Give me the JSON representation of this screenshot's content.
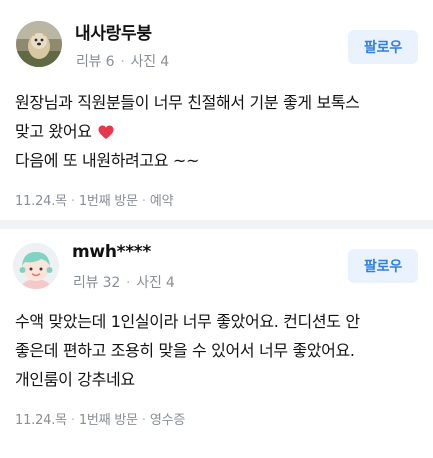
{
  "reviews": [
    {
      "author": "내사랑두붕",
      "stats": {
        "reviews": "리뷰 6",
        "photos": "사진 4"
      },
      "follow_label": "팔로우",
      "body": {
        "line1": "원장님과 직원분들이 너무 친절해서 기분 좋게 보톡스",
        "line2": "맞고 왔어요",
        "line3": "다음에 또 내원하려고요 ~~"
      },
      "meta": {
        "date": "11.24.목",
        "visit": "1번째 방문",
        "verification": "예약"
      }
    },
    {
      "author": "mwh****",
      "stats": {
        "reviews": "리뷰 32",
        "photos": "사진 4"
      },
      "follow_label": "팔로우",
      "body": {
        "line1": "수액 맞았는데 1인실이라 너무 좋았어요. 컨디션도 안",
        "line2": "좋은데 편하고 조용히 맞을 수 있어서 너무 좋았어요.",
        "line3": "개인룸이 강추네요"
      },
      "meta": {
        "date": "11.24.목",
        "visit": "1번째 방문",
        "verification": "영수증"
      }
    }
  ],
  "colors": {
    "accent": "#2f7fe6",
    "follow_bg": "#eaf3fd",
    "muted_text": "#8a8f96",
    "divider": "#f2f3f5",
    "heart": "#e8364a"
  },
  "icons": {
    "avatar_1": "dog-photo-avatar",
    "avatar_2": "cartoon-face-avatar",
    "emoji": "red-heart-icon"
  }
}
